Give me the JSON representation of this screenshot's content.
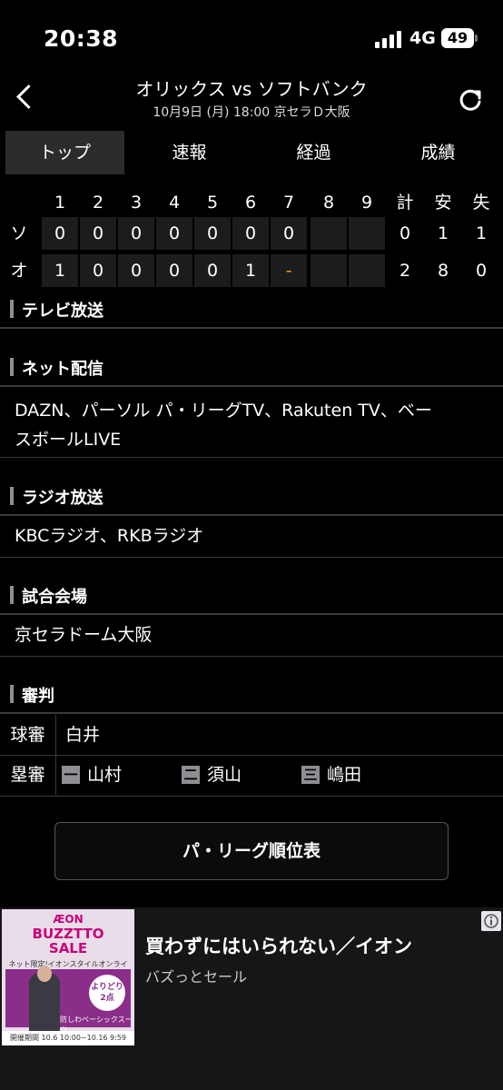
{
  "status": {
    "time": "20:38",
    "network": "4G",
    "battery": "49"
  },
  "header": {
    "title": "オリックス vs ソフトバンク",
    "subtitle": "10月9日 (月) 18:00 京セラＤ大阪"
  },
  "tabs": [
    "トップ",
    "速報",
    "経過",
    "成績"
  ],
  "scoreboard": {
    "headers": [
      "1",
      "2",
      "3",
      "4",
      "5",
      "6",
      "7",
      "8",
      "9",
      "計",
      "安",
      "失"
    ],
    "rows": [
      {
        "team": "ソ",
        "innings": [
          "0",
          "0",
          "0",
          "0",
          "0",
          "0",
          "0",
          "",
          ""
        ],
        "totals": [
          "0",
          "1",
          "1"
        ]
      },
      {
        "team": "オ",
        "innings": [
          "1",
          "0",
          "0",
          "0",
          "0",
          "1",
          "-",
          "",
          ""
        ],
        "totals": [
          "2",
          "8",
          "0"
        ]
      }
    ]
  },
  "sections": {
    "tv": {
      "title": "テレビ放送"
    },
    "net": {
      "title": "ネット配信",
      "line1": "DAZN、パーソル パ・リーグTV、Rakuten TV、ベー",
      "line2": "スボールLIVE"
    },
    "radio": {
      "title": "ラジオ放送",
      "body": "KBCラジオ、RKBラジオ"
    },
    "venue": {
      "title": "試合会場",
      "body": "京セラドーム大阪"
    },
    "umpire": {
      "title": "審判",
      "chief_label": "球審",
      "chief": "白井",
      "base_label": "塁審",
      "bases": [
        {
          "mark": "一",
          "name": "山村"
        },
        {
          "mark": "二",
          "name": "須山"
        },
        {
          "mark": "三",
          "name": "嶋田"
        }
      ]
    }
  },
  "standings_button": "パ・リーグ順位表",
  "ad": {
    "title": "買わずにはいられない／イオン",
    "sub": "バズっとセール",
    "image": {
      "brand": "ÆON",
      "headline1": "BUZZTTO",
      "headline2": "SALE",
      "note": "ネット限定!イオンスタイルオンラインで開催!",
      "offer1": "よりどり",
      "offer2": "2点",
      "product": "防しわベーシックスーツ",
      "period": "開催期間 10.6 10:00~10.16 9:59"
    }
  }
}
